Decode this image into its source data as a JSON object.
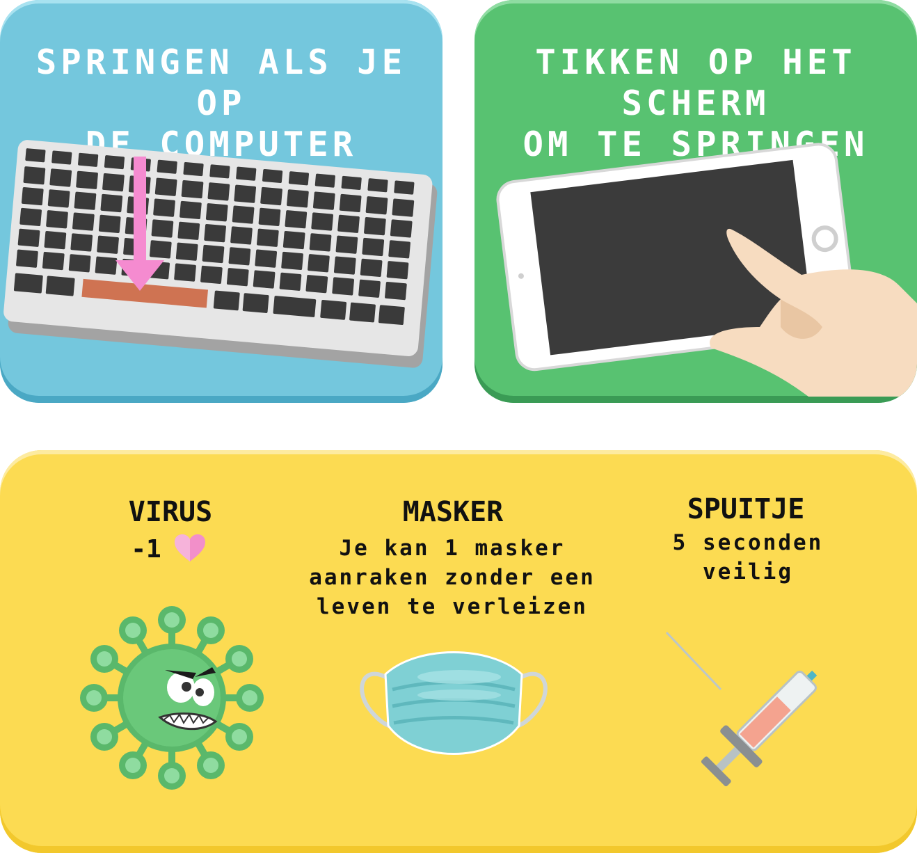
{
  "panels": {
    "keyboard": {
      "title": "SPRINGEN ALS JE OP\nDE COMPUTER SPEELT",
      "color": "#74c7dd"
    },
    "tablet": {
      "title": "TIKKEN OP HET SCHERM\nOM TE SPRINGEN",
      "color": "#58c271"
    },
    "items": {
      "color": "#fcdb52",
      "virus": {
        "name": "VIRUS",
        "effect": "-1",
        "icon": "heart-icon"
      },
      "mask": {
        "name": "MASKER",
        "description": "Je kan 1 masker\naanraken zonder een\nleven te verleizen"
      },
      "syringe": {
        "name": "SPUITJE",
        "description": "5 seconden\nveilig"
      }
    }
  }
}
